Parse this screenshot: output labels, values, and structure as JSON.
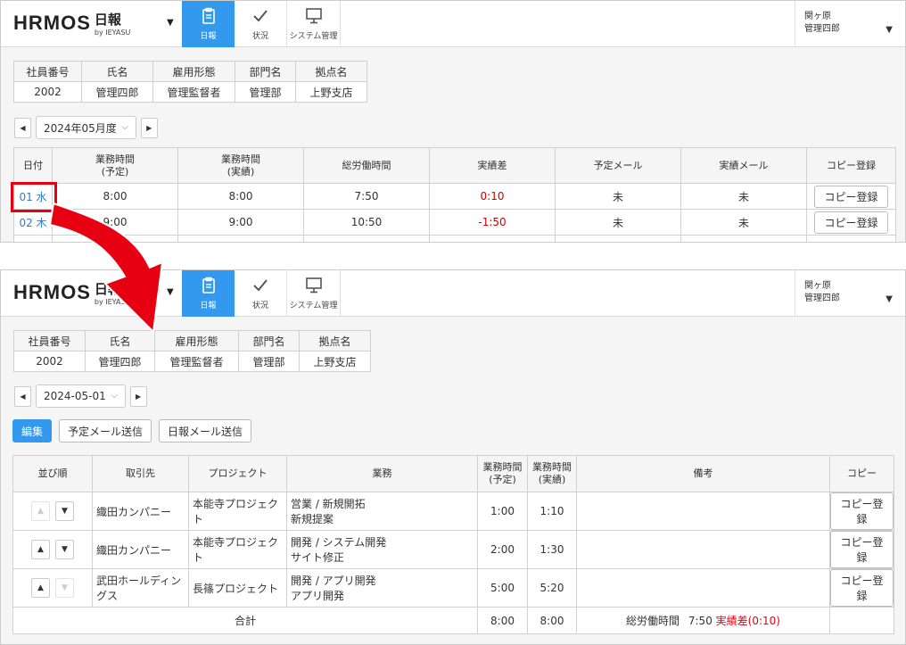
{
  "app": {
    "logo": "HRMOS",
    "app_name": "日報",
    "by": "by IEYASU",
    "nav": [
      {
        "label": "日報",
        "icon": "clipboard-icon",
        "active": true
      },
      {
        "label": "状況",
        "icon": "check-icon",
        "active": false
      },
      {
        "label": "システム管理",
        "icon": "monitor-icon",
        "active": false
      }
    ],
    "user": {
      "line1": "関ヶ原",
      "line2": "管理四郎"
    }
  },
  "employee": {
    "headers": [
      "社員番号",
      "氏名",
      "雇用形態",
      "部門名",
      "拠点名"
    ],
    "values": [
      "2002",
      "管理四郎",
      "管理監督者",
      "管理部",
      "上野支店"
    ]
  },
  "top": {
    "month_select": "2024年05月度",
    "headers": [
      "日付",
      "業務時間\n(予定)",
      "業務時間\n(実績)",
      "総労働時間",
      "実績差",
      "予定メール",
      "実績メール",
      "コピー登録"
    ],
    "rows": [
      {
        "date": "01 水",
        "plan": "8:00",
        "actual": "8:00",
        "total": "7:50",
        "diff": "0:10",
        "plan_mail": "未",
        "actual_mail": "未",
        "copy": "コピー登録"
      },
      {
        "date": "02 木",
        "plan": "9:00",
        "actual": "9:00",
        "total": "10:50",
        "diff": "-1:50",
        "plan_mail": "未",
        "actual_mail": "未",
        "copy": "コピー登録"
      }
    ]
  },
  "bottom": {
    "date_select": "2024-05-01",
    "buttons": {
      "edit": "編集",
      "plan_mail": "予定メール送信",
      "daily_mail": "日報メール送信"
    },
    "headers": {
      "order": "並び順",
      "client": "取引先",
      "project": "プロジェクト",
      "task": "業務",
      "plan": "業務時間\n(予定)",
      "actual": "業務時間\n(実績)",
      "remarks": "備考",
      "copy": "コピー"
    },
    "rows": [
      {
        "client": "織田カンパニー",
        "project": "本能寺プロジェクト",
        "task1": "営業 / 新規開拓",
        "task2": "新規提案",
        "plan": "1:00",
        "actual": "1:10",
        "copy": "コピー登録"
      },
      {
        "client": "織田カンパニー",
        "project": "本能寺プロジェクト",
        "task1": "開発 / システム開発",
        "task2": "サイト修正",
        "plan": "2:00",
        "actual": "1:30",
        "copy": "コピー登録"
      },
      {
        "client": "武田ホールディングス",
        "project": "長篠プロジェクト",
        "task1": "開発 / アプリ開発",
        "task2": "アプリ開発",
        "plan": "5:00",
        "actual": "5:20",
        "copy": "コピー登録"
      }
    ],
    "total": {
      "label": "合計",
      "plan": "8:00",
      "actual": "8:00",
      "total_label": "総労働時間",
      "total_value": "7:50",
      "diff_label": "実績差(0:10)"
    }
  },
  "colors": {
    "accent": "#3399ee",
    "link": "#2b7bd1",
    "alert": "#e60012"
  }
}
